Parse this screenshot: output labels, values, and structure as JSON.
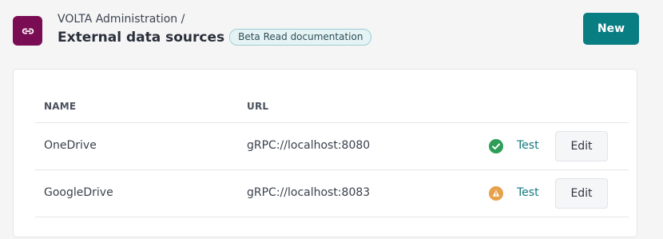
{
  "header": {
    "breadcrumb": "VOLTA Administration /",
    "title": "External data sources",
    "badge": "Beta Read documentation",
    "new_button": "New",
    "app_icon": "link-icon",
    "app_icon_color": "#7a0c54"
  },
  "table": {
    "columns": [
      "NAME",
      "URL"
    ],
    "rows": [
      {
        "name": "OneDrive",
        "url": "gRPC://localhost:8080",
        "status": "success",
        "status_icon": "check-circle-icon",
        "status_color": "#2f9d57",
        "test_label": "Test",
        "edit_label": "Edit"
      },
      {
        "name": "GoogleDrive",
        "url": "gRPC://localhost:8083",
        "status": "warning",
        "status_icon": "warning-circle-icon",
        "status_color": "#e6a24b",
        "test_label": "Test",
        "edit_label": "Edit"
      }
    ]
  },
  "colors": {
    "accent": "#087e83",
    "link": "#107a7f",
    "badge_bg": "#e6f3f4"
  }
}
